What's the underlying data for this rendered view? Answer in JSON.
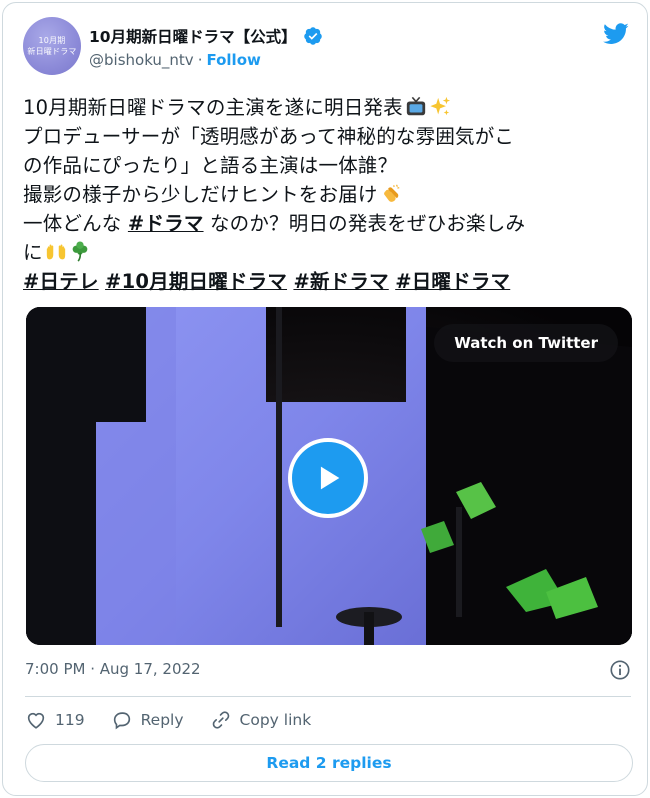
{
  "account": {
    "display_name": "10月期新日曜ドラマ【公式】",
    "handle": "@bishoku_ntv",
    "separator": "·",
    "follow_label": "Follow",
    "avatar_line1": "10月期",
    "avatar_line2": "新日曜ドラマ"
  },
  "tweet": {
    "line1": "10月期新日曜ドラマの主演を遂に明日発表",
    "line2": "プロデューサーが「透明感があって神秘的な雰囲気がこ",
    "line3": "の作品にぴったり」と語る主演は一体誰？",
    "line4": "撮影の様子から少しだけヒントをお届け",
    "line5_pre": "一体どんな ",
    "line5_hashtag": "#ドラマ",
    "line5_post": " なのか？明日の発表をぜひお楽しみ",
    "line6": "に",
    "hashtags": [
      "#日テレ",
      "#10月期日曜ドラマ",
      "#新ドラマ",
      "#日曜ドラマ"
    ]
  },
  "media": {
    "watch_label": "Watch on Twitter"
  },
  "meta": {
    "timestamp": "7:00 PM · Aug 17, 2022"
  },
  "actions": {
    "like_count": "119",
    "reply_label": "Reply",
    "copy_label": "Copy link"
  },
  "footer": {
    "read_replies_label": "Read 2 replies"
  },
  "colors": {
    "accent": "#1d9bf0",
    "text": "#0f1419",
    "muted": "#536471",
    "border": "#cfd9de"
  },
  "icons": [
    "verified-badge-icon",
    "twitter-bird-icon",
    "tv-emoji-icon",
    "sparkles-emoji-icon",
    "clapping-hands-emoji-icon",
    "open-hands-emoji-icon",
    "shamrock-emoji-icon",
    "play-icon",
    "info-icon",
    "heart-icon",
    "reply-icon",
    "link-icon"
  ]
}
